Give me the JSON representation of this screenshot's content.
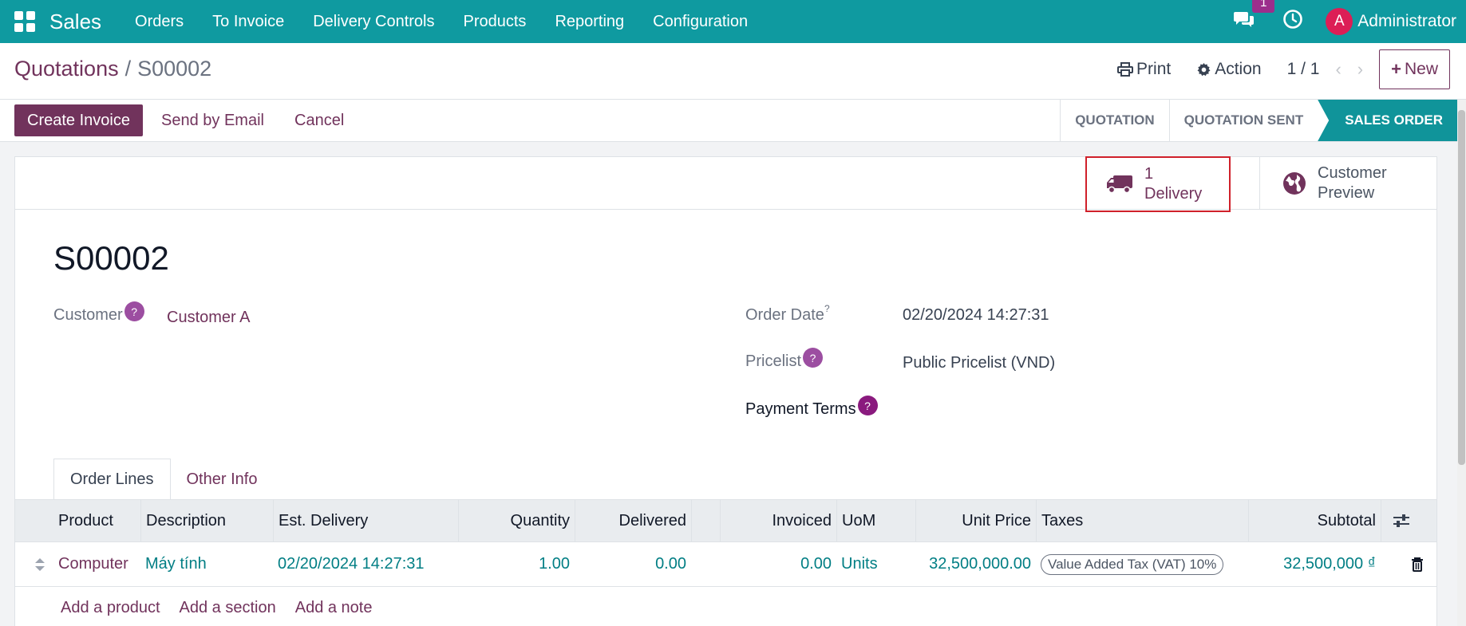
{
  "navbar": {
    "app_name": "Sales",
    "menu": [
      "Orders",
      "To Invoice",
      "Delivery Controls",
      "Products",
      "Reporting",
      "Configuration"
    ],
    "chat_badge": "1",
    "avatar_initial": "A",
    "user_name": "Administrator"
  },
  "control_panel": {
    "breadcrumb_parent": "Quotations",
    "breadcrumb_separator": "/",
    "breadcrumb_current": "S00002",
    "print_label": "Print",
    "action_label": "Action",
    "pager": "1 / 1",
    "new_label": "New"
  },
  "statusbar": {
    "create_invoice": "Create Invoice",
    "send_by_email": "Send by Email",
    "cancel": "Cancel",
    "stages": [
      "QUOTATION",
      "QUOTATION SENT",
      "SALES ORDER"
    ],
    "active_stage": "SALES ORDER"
  },
  "smart_buttons": {
    "delivery_count": "1",
    "delivery_label": "Delivery",
    "preview_line1": "Customer",
    "preview_line2": "Preview"
  },
  "record": {
    "name": "S00002",
    "customer_label": "Customer",
    "customer_value": "Customer A",
    "order_date_label": "Order Date",
    "order_date_value": "02/20/2024 14:27:31",
    "pricelist_label": "Pricelist",
    "pricelist_value": "Public Pricelist (VND)",
    "payment_terms_label": "Payment Terms",
    "help_mark": "?"
  },
  "tabs": [
    "Order Lines",
    "Other Info"
  ],
  "table": {
    "columns": [
      "Product",
      "Description",
      "Est. Delivery",
      "Quantity",
      "Delivered",
      "Invoiced",
      "UoM",
      "Unit Price",
      "Taxes",
      "Subtotal"
    ],
    "rows": [
      {
        "product": "Computer",
        "description": "Máy tính",
        "est_delivery": "02/20/2024 14:27:31",
        "quantity": "1.00",
        "delivered": "0.00",
        "invoiced": "0.00",
        "uom": "Units",
        "unit_price": "32,500,000.00",
        "taxes": "Value Added Tax (VAT) 10%",
        "subtotal": "32,500,000 ₫"
      }
    ],
    "add_links": [
      "Add a product",
      "Add a section",
      "Add a note"
    ]
  },
  "colors": {
    "navbar": "#0f9aa0",
    "brand_purple": "#71335c",
    "active_stage": "#10949a",
    "highlight_border": "#d0202a"
  }
}
